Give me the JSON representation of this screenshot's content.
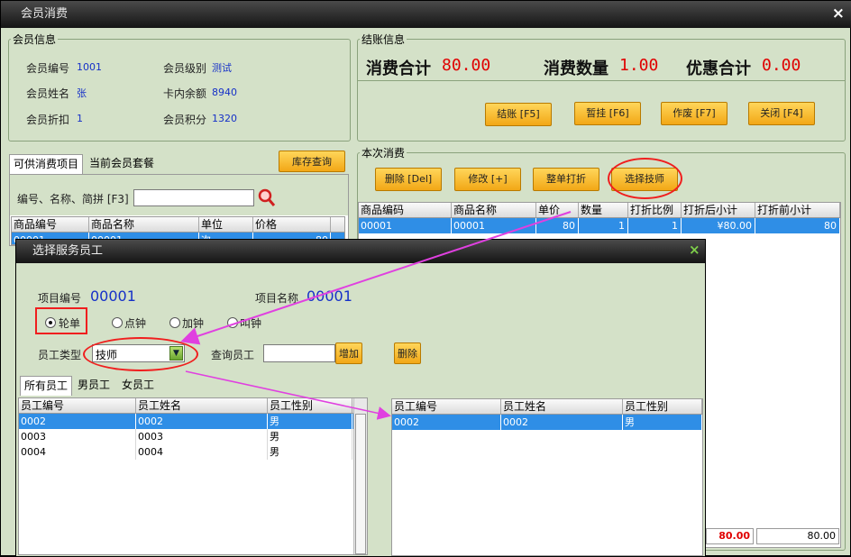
{
  "window": {
    "title": "会员消费",
    "close": "×"
  },
  "member": {
    "legend": "会员信息",
    "no_label": "会员编号",
    "no": "1001",
    "level_label": "会员级别",
    "level": "测试",
    "name_label": "会员姓名",
    "name": "张",
    "balance_label": "卡内余额",
    "balance": "8940",
    "discount_label": "会员折扣",
    "discount": "1",
    "points_label": "会员积分",
    "points": "1320"
  },
  "checkout": {
    "legend": "结账信息",
    "total_label": "消费合计",
    "total": "80.00",
    "qty_label": "消费数量",
    "qty": "1.00",
    "disc_label": "优惠合计",
    "disc": "0.00",
    "btn_pay": "结账 [F5]",
    "btn_hold": "暂挂 [F6]",
    "btn_void": "作废 [F7]",
    "btn_close": "关闭 [F4]"
  },
  "tabs": {
    "items": "可供消费项目",
    "packages": "当前会员套餐"
  },
  "stock_btn": "库存查询",
  "search": {
    "label": "编号、名称、简拼 [F3]"
  },
  "product_grid": {
    "headers": [
      "商品编号",
      "商品名称",
      "单位",
      "价格"
    ],
    "row": [
      "00001",
      "00001",
      "次",
      "80"
    ]
  },
  "current": {
    "legend": "本次消费",
    "btn_delete": "删除 [Del]",
    "btn_modify": "修改 [+]",
    "btn_discount": "整单打折",
    "btn_tech": "选择技师",
    "headers": [
      "商品编码",
      "商品名称",
      "单价",
      "数量",
      "打折比例",
      "打折后小计",
      "打折前小计"
    ],
    "row": [
      "00001",
      "00001",
      "80",
      "1",
      "1",
      "¥80.00",
      "80"
    ],
    "footer_after": "80.00",
    "footer_before": "80.00"
  },
  "dialog": {
    "title": "选择服务员工",
    "close": "×",
    "item_no_label": "项目编号",
    "item_no": "00001",
    "item_name_label": "项目名称",
    "item_name": "00001",
    "radios": [
      "轮单",
      "点钟",
      "加钟",
      "叫钟"
    ],
    "type_label": "员工类型",
    "type_value": "技师",
    "query_label": "查询员工",
    "btn_add": "增加",
    "btn_del": "删除",
    "tabs": [
      "所有员工",
      "男员工",
      "女员工"
    ],
    "left_headers": [
      "员工编号",
      "员工姓名",
      "员工性别"
    ],
    "left_rows": [
      [
        "0002",
        "0002",
        "男"
      ],
      [
        "0003",
        "0003",
        "男"
      ],
      [
        "0004",
        "0004",
        "男"
      ]
    ],
    "right_headers": [
      "员工编号",
      "员工姓名",
      "员工性别"
    ],
    "right_rows": [
      [
        "0002",
        "0002",
        "男"
      ]
    ]
  },
  "colors": {
    "accent": "#f01e1e",
    "selection": "#2f8ee6",
    "annotation_arrow": "#e040e0",
    "button": "#f2a716"
  }
}
